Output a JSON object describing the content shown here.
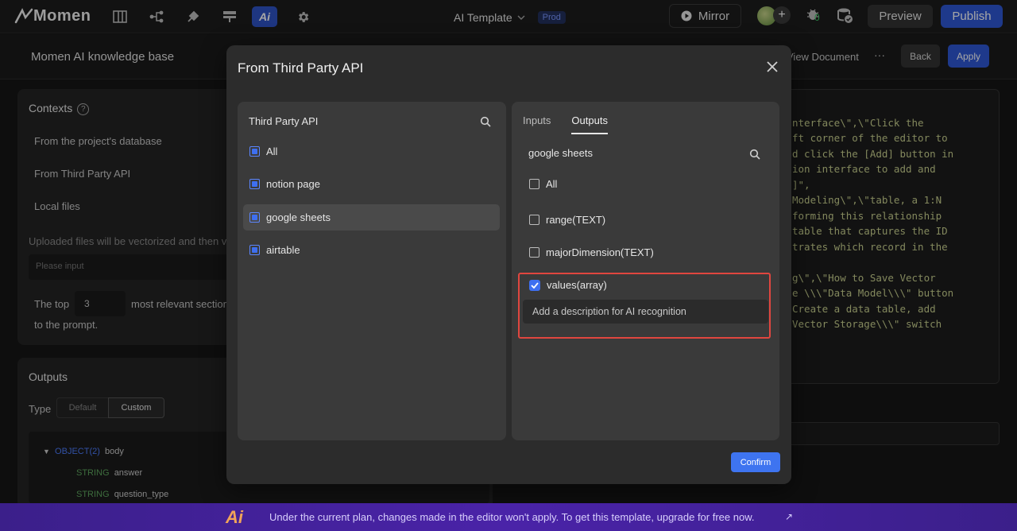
{
  "topbar": {
    "logo": "Momen",
    "ai_icon_label": "Ai",
    "template_name": "AI Template",
    "env_badge": "Prod",
    "mirror_label": "Mirror",
    "bug_count": "0",
    "preview_label": "Preview",
    "publish_label": "Publish"
  },
  "subheader": {
    "title": "Momen AI knowledge base",
    "view_document": "View Document",
    "more": "···",
    "back_label": "Back",
    "apply_label": "Apply"
  },
  "contexts_panel": {
    "title": "Contexts",
    "items": [
      "From the project's database",
      "From Third Party API",
      "Local files"
    ],
    "upload_note": "Uploaded files will be vectorized and then v",
    "input_placeholder": "Please input",
    "top_prefix": "The top",
    "top_value": "3",
    "top_suffix": "most relevant section",
    "top_suffix2": "to the prompt."
  },
  "outputs_panel": {
    "title": "Outputs",
    "type_label": "Type",
    "type_options": [
      "Default",
      "Custom"
    ],
    "type_selected": "Custom",
    "tree": [
      {
        "type": "OBJECT(2)",
        "name": "body"
      },
      {
        "type": "STRING",
        "name": "answer"
      },
      {
        "type": "STRING",
        "name": "question_type"
      }
    ]
  },
  "code_panel": {
    "lines": [
      "nterface\\\",\\\"Click the",
      "ft corner of the editor to",
      "d click the [Add] button in",
      "ion interface to add and",
      "]\",",
      " Modeling\\\",\\\"table, a 1:N",
      "forming this relationship",
      " table that captures the ID",
      "trates which record in the",
      "",
      "g\\\",\\\"How to Save Vector",
      "e \\\\\\\"Data Model\\\\\\\" button",
      " Create a data table, add",
      "Vector Storage\\\\\\\" switch"
    ]
  },
  "modal": {
    "title": "From Third Party API",
    "left": {
      "header": "Third Party API",
      "items": [
        {
          "label": "All",
          "checked": true
        },
        {
          "label": "notion page",
          "checked": true
        },
        {
          "label": "google sheets",
          "checked": true,
          "selected": true
        },
        {
          "label": "airtable",
          "checked": true
        }
      ]
    },
    "right": {
      "tabs": [
        "Inputs",
        "Outputs"
      ],
      "active_tab": "Outputs",
      "search_value": "google sheets",
      "items": [
        {
          "label": "All",
          "checked": false
        },
        {
          "label": "range(TEXT)",
          "checked": false
        },
        {
          "label": "majorDimension(TEXT)",
          "checked": false
        },
        {
          "label": "values(array)",
          "checked": true
        }
      ],
      "description_placeholder": "Add a description for AI recognition"
    },
    "confirm_label": "Confirm"
  },
  "banner": {
    "logo": "Ai",
    "text": "Under the current plan, changes made in the editor won't apply. To get this template, upgrade for free now.",
    "arrow": "↗"
  },
  "colors": {
    "accent_blue": "#2f58d6",
    "highlight_red": "#e0463f",
    "banner_purple": "#4a23a8"
  }
}
